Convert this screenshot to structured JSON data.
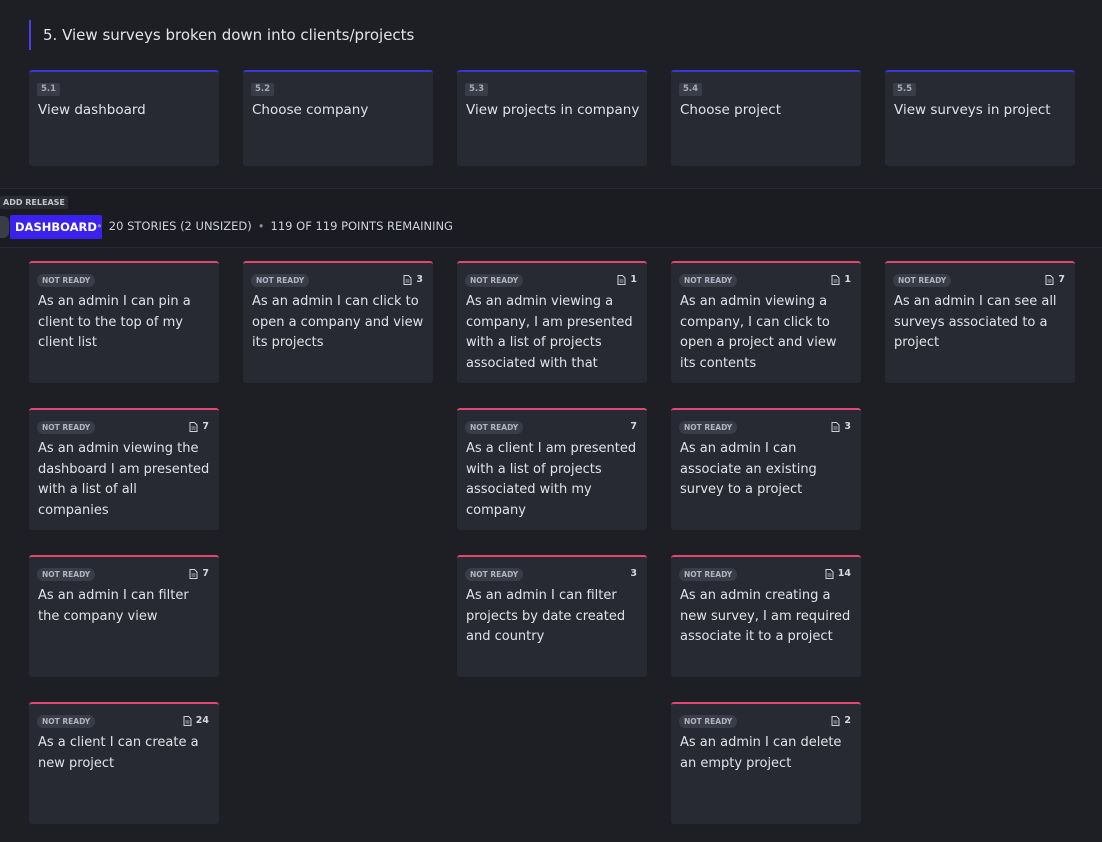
{
  "epic": {
    "title": "5. View surveys broken down into clients/projects"
  },
  "activities": [
    {
      "tag": "5.1",
      "label": "View dashboard"
    },
    {
      "tag": "5.2",
      "label": "Choose company"
    },
    {
      "tag": "5.3",
      "label": "View projects in company"
    },
    {
      "tag": "5.4",
      "label": "Choose project"
    },
    {
      "tag": "5.5",
      "label": "View surveys in project"
    }
  ],
  "release": {
    "add_label": "ADD RELEASE",
    "name": "DASHBOARD",
    "stories_summary": "20 STORIES (2 UNSIZED)",
    "points_summary": "119 OF 119 POINTS REMAINING",
    "separator": "•"
  },
  "stories": [
    {
      "status": "NOT READY",
      "points": "",
      "text": "As an admin I can pin a client to the top of my client list"
    },
    {
      "status": "NOT READY",
      "points": "3",
      "text": "As an admin I can click to open a company and view its projects"
    },
    {
      "status": "NOT READY",
      "points": "1",
      "text": "As an admin viewing a company, I am presented with a list of projects associated with that"
    },
    {
      "status": "NOT READY",
      "points": "1",
      "text": "As an admin viewing a company, I can click to open a project and view its contents"
    },
    {
      "status": "NOT READY",
      "points": "7",
      "text": "As an admin I can see all surveys associated to a project"
    },
    {
      "status": "NOT READY",
      "points": "7",
      "text": "As an admin viewing the dashboard I am presented with a list of all companies"
    },
    {
      "status": "NOT READY",
      "points": "7",
      "text": "As a client I am presented with a list of projects associated with my company"
    },
    {
      "status": "NOT READY",
      "points": "3",
      "text": "As an admin I can associate an existing survey to a project"
    },
    {
      "status": "NOT READY",
      "points": "7",
      "text": "As an admin I can filter the company view"
    },
    {
      "status": "NOT READY",
      "points": "3",
      "text": "As an admin I can filter projects by date created and country"
    },
    {
      "status": "NOT READY",
      "points": "14",
      "text": "As an admin creating a new survey, I am required associate it to a project"
    },
    {
      "status": "NOT READY",
      "points": "24",
      "text": "As a client I can create a new project"
    },
    {
      "status": "NOT READY",
      "points": "2",
      "text": "As an admin I can delete an empty project"
    }
  ],
  "colors": {
    "activity_accent": "#3b34d8",
    "story_accent": "#e0486f",
    "release_accent": "#3b21f0"
  }
}
